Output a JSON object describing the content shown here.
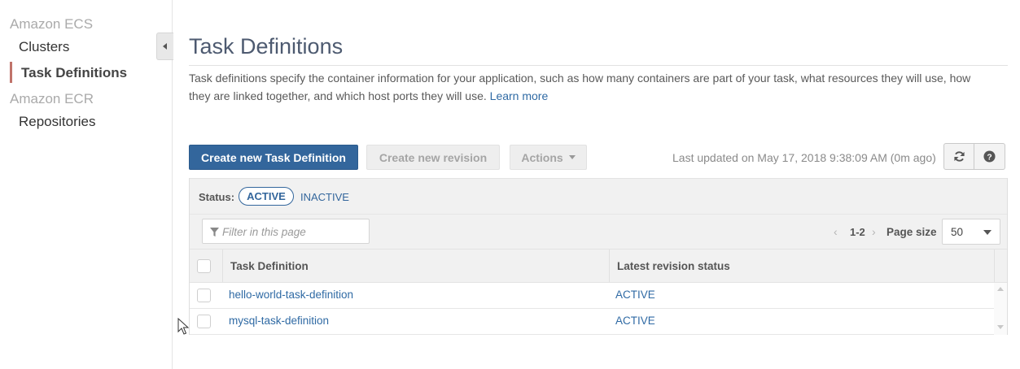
{
  "sidebar": {
    "sections": [
      {
        "title": "Amazon ECS",
        "items": [
          "Clusters",
          "Task Definitions"
        ]
      },
      {
        "title": "Amazon ECR",
        "items": [
          "Repositories"
        ]
      }
    ],
    "active_item": "Task Definitions"
  },
  "page": {
    "title": "Task Definitions",
    "description": "Task definitions specify the container information for your application, such as how many containers are part of your task, what resources they will use, how they are linked together, and which host ports they will use.",
    "learn_more": "Learn more"
  },
  "toolbar": {
    "create_label": "Create new Task Definition",
    "revision_label": "Create new revision",
    "actions_label": "Actions",
    "last_updated": "Last updated on May 17, 2018 9:38:09 AM (0m ago)",
    "refresh_icon": "refresh-icon",
    "help_icon": "help-icon"
  },
  "status_filter": {
    "label": "Status:",
    "active": "ACTIVE",
    "inactive": "INACTIVE"
  },
  "filter": {
    "placeholder": "Filter in this page"
  },
  "pagination": {
    "range": "1-2",
    "page_size_label": "Page size",
    "page_size": "50"
  },
  "table": {
    "columns": [
      "Task Definition",
      "Latest revision status"
    ],
    "rows": [
      {
        "name": "hello-world-task-definition",
        "status": "ACTIVE"
      },
      {
        "name": "mysql-task-definition",
        "status": "ACTIVE"
      }
    ]
  },
  "colors": {
    "primary": "#33669c",
    "link": "#2f6aa4",
    "active_accent": "#c0736a"
  }
}
